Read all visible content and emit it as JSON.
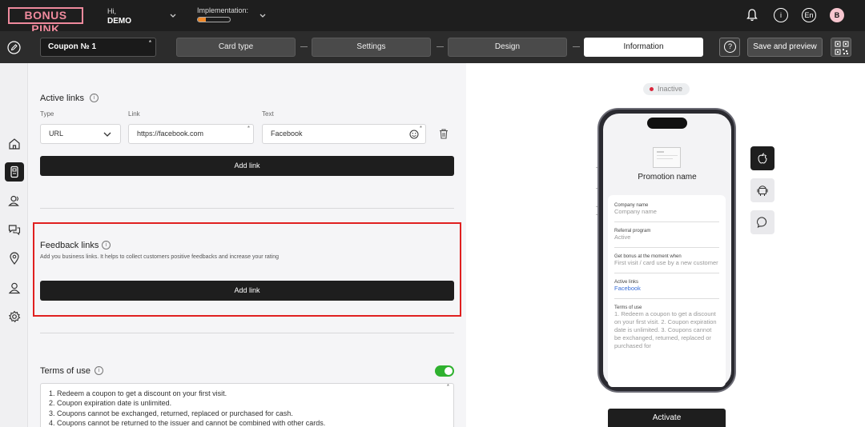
{
  "header": {
    "logo": "BONUS PINK",
    "greeting": "Hi,",
    "user": "DEMO",
    "implementation_label": "Implementation:",
    "implementation_progress": 0.25,
    "language": "En",
    "avatar_letter": "B",
    "info_glyph": "i"
  },
  "toolbar": {
    "coupon_name": "Coupon № 1",
    "required_mark": "*",
    "steps": [
      "Card type",
      "Settings",
      "Design",
      "Information"
    ],
    "active_step": "Information",
    "help_glyph": "?",
    "save_label": "Save and preview"
  },
  "active_links": {
    "title": "Active links",
    "type_label": "Type",
    "link_label": "Link",
    "text_label": "Text",
    "type_value": "URL",
    "link_value": "https://facebook.com",
    "text_value": "Facebook",
    "add_label": "Add link"
  },
  "feedback_links": {
    "title": "Feedback links",
    "description": "Add you business links. It helps to collect customers positive feedbacks and increase your rating",
    "add_label": "Add link"
  },
  "terms": {
    "title": "Terms of use",
    "enabled": true,
    "lines": [
      "1. Redeem a coupon to get a discount on your first visit.",
      "2. Coupon expiration date is unlimited.",
      "3. Coupons cannot be exchanged, returned, replaced or purchased for cash.",
      "4. Coupons cannot be returned to the issuer and cannot be combined with other cards."
    ]
  },
  "preview": {
    "status": "Inactive",
    "promotion_name": "Promotion name",
    "company_label": "Company name",
    "company_value": "Company name",
    "referral_label": "Referral program",
    "referral_value": "Active",
    "bonus_label": "Get bonus at the moment when",
    "bonus_value": "First visit / card use by a new customer",
    "links_label": "Active links",
    "links_value": "Facebook",
    "terms_label": "Terms of use",
    "terms_value": "1. Redeem a coupon to get a discount on your first visit. 2. Coupon expiration date is unlimited. 3. Coupons cannot be exchanged, returned, replaced or purchased for",
    "activate_label": "Activate"
  },
  "colors": {
    "brand": "#ef8a9d",
    "dark": "#1e1e1e",
    "toggle_on": "#2fb12f",
    "highlight": "#e02020",
    "inactive_dot": "#d9253a"
  }
}
